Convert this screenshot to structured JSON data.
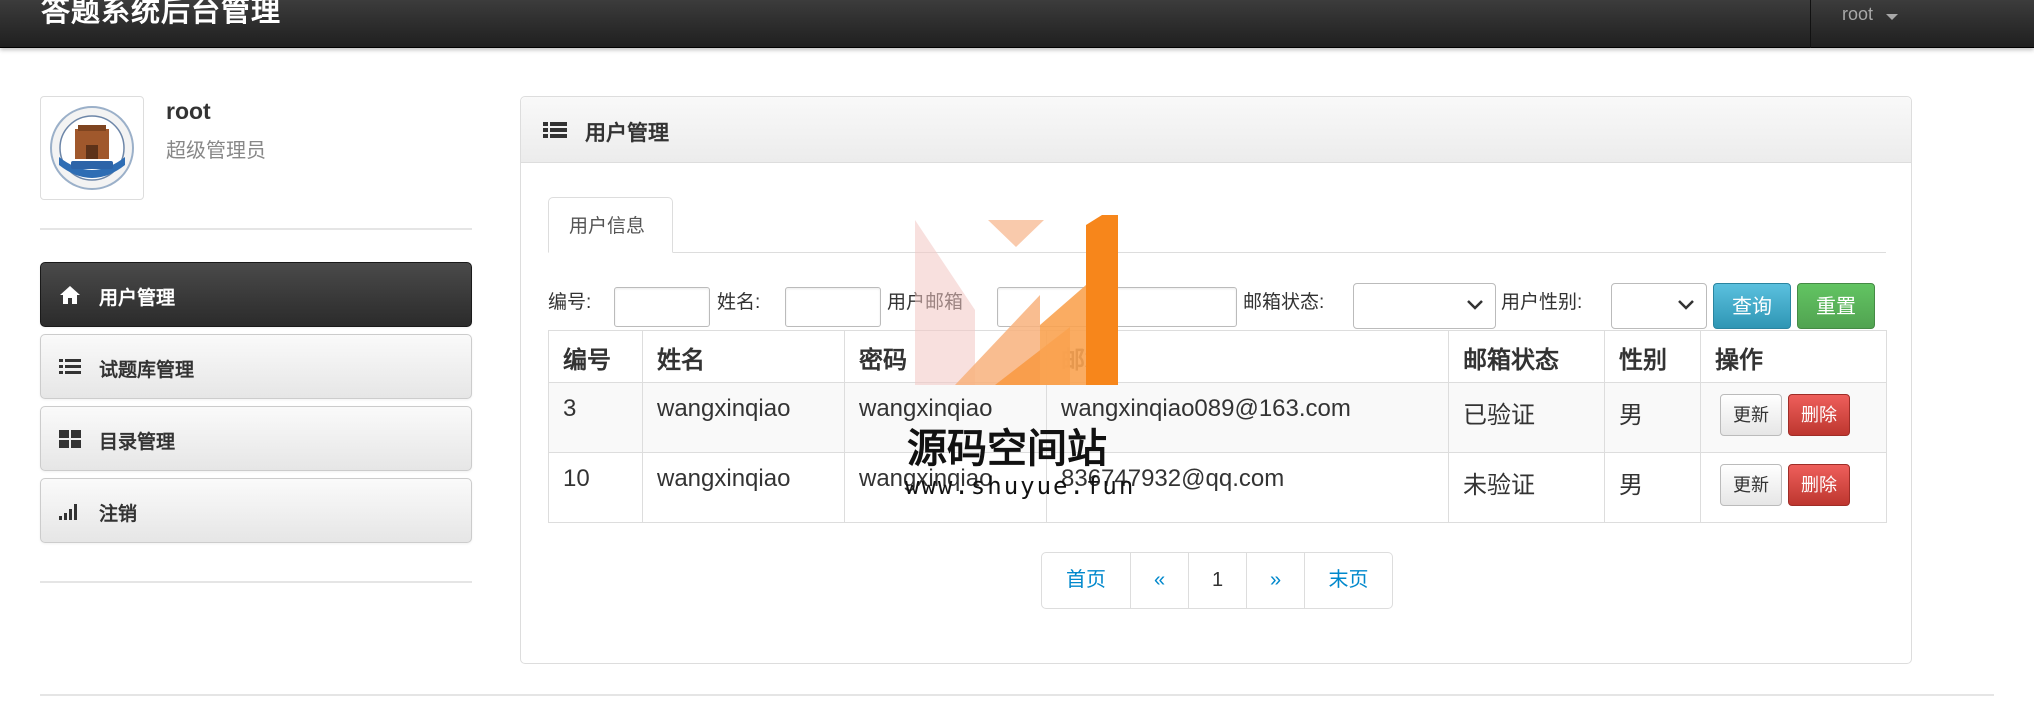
{
  "app": {
    "title": "答题系统后台管理"
  },
  "user_menu": {
    "username": "root"
  },
  "profile": {
    "name": "root",
    "role": "超级管理员"
  },
  "sidebar": {
    "items": [
      {
        "label": "用户管理",
        "icon": "home-icon",
        "active": true
      },
      {
        "label": "试题库管理",
        "icon": "list-icon",
        "active": false
      },
      {
        "label": "目录管理",
        "icon": "grid-icon",
        "active": false
      },
      {
        "label": "注销",
        "icon": "signal-bars-icon",
        "active": false
      }
    ]
  },
  "panel": {
    "title": "用户管理",
    "icon": "list-icon"
  },
  "tabs": [
    {
      "label": "用户信息",
      "active": true
    }
  ],
  "filters": {
    "id_label": "编号:",
    "name_label": "姓名:",
    "email_label": "用户邮箱",
    "email_status_label": "邮箱状态:",
    "gender_label": "用户性别:",
    "query_button": "查询",
    "reset_button": "重置"
  },
  "table": {
    "headers": [
      "编号",
      "姓名",
      "密码",
      "邮箱",
      "邮箱状态",
      "性别",
      "操作"
    ],
    "rows": [
      {
        "id": "3",
        "name": "wangxinqiao",
        "password": "wangxinqiao",
        "email": "wangxinqiao089@163.com",
        "email_status": "已验证",
        "gender": "男",
        "update": "更新",
        "delete": "删除"
      },
      {
        "id": "10",
        "name": "wangxinqiao",
        "password": "wangxinqiao",
        "email": "836747932@qq.com",
        "email_status": "未验证",
        "gender": "男",
        "update": "更新",
        "delete": "删除"
      }
    ]
  },
  "pagination": {
    "first": "首页",
    "prev": "«",
    "current": "1",
    "next": "»",
    "last": "末页"
  },
  "watermark": {
    "title": "源码空间站",
    "url": "www.shuyue.fun"
  },
  "colors": {
    "navbar": "#2b2b2b",
    "info": "#49afcd",
    "success": "#5bb75b",
    "danger": "#da4f49",
    "link": "#0088cc"
  }
}
